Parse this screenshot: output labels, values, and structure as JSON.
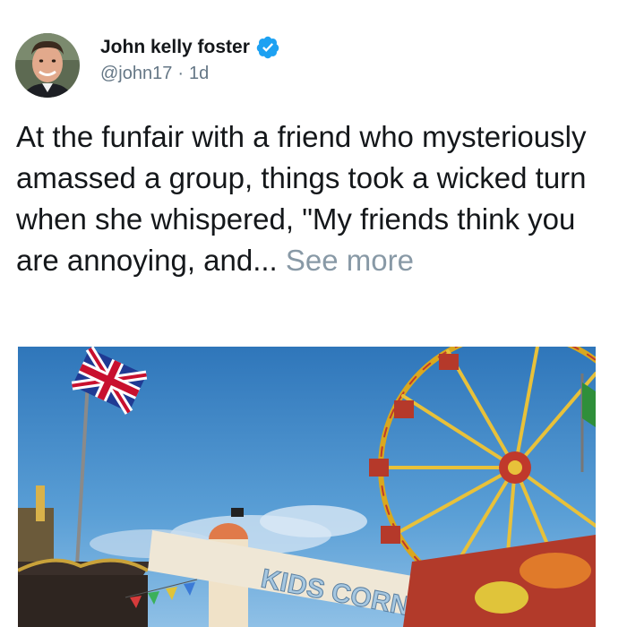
{
  "tweet": {
    "author": {
      "display_name": "John kelly foster",
      "handle": "@john17",
      "verified_icon": "verified-badge-icon",
      "avatar_icon": "profile-photo"
    },
    "separator": "·",
    "timestamp": "1d",
    "text": "At the funfair with a friend who mysteriously amassed a group, things took a wicked turn when she whispered, \"My friends think you are annoying, and...",
    "see_more_label": "See more",
    "media": {
      "banner_text": "KIDS CORNER"
    }
  },
  "colors": {
    "text_primary": "#14171a",
    "text_secondary": "#657786",
    "see_more": "#8899a6",
    "verified_blue": "#1da1f2",
    "sky": "#3d86c8"
  }
}
